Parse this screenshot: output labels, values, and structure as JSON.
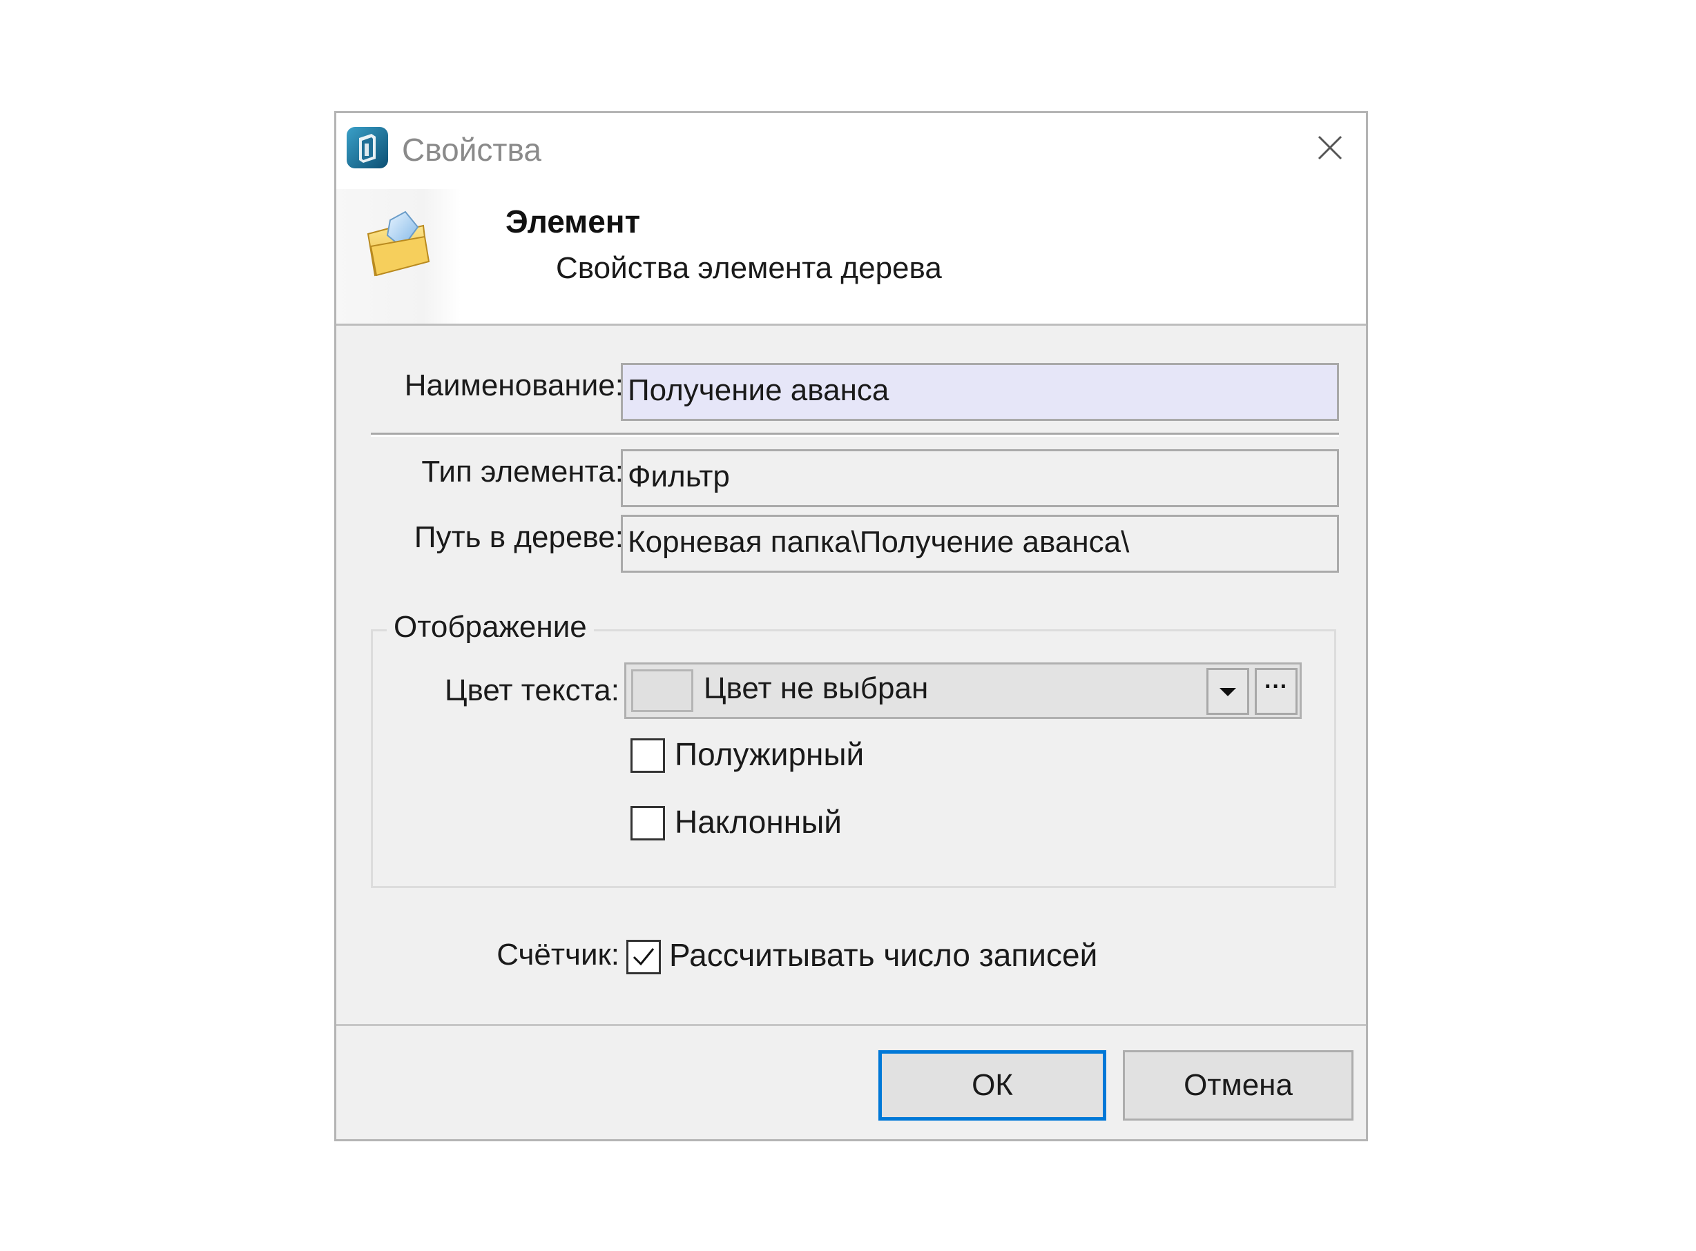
{
  "window": {
    "title": "Свойства",
    "close_icon": "close-icon"
  },
  "header": {
    "title": "Элемент",
    "subtitle": "Свойства элемента дерева",
    "icon": "folder-element-icon"
  },
  "form": {
    "name_label": "Наименование:",
    "name_value": "Получение аванса",
    "type_label": "Тип элемента:",
    "type_value": "Фильтр",
    "path_label": "Путь в дереве:",
    "path_value": "Корневая папка\\Получение аванса\\"
  },
  "display_group": {
    "legend": "Отображение",
    "text_color_label": "Цвет текста:",
    "text_color_value": "Цвет не выбран",
    "more_button": "···",
    "bold_label": "Полужирный",
    "bold_checked": false,
    "italic_label": "Наклонный",
    "italic_checked": false
  },
  "counter": {
    "label": "Счётчик:",
    "checkbox_label": "Рассчитывать число записей",
    "checked": true
  },
  "buttons": {
    "ok": "ОК",
    "cancel": "Отмена"
  },
  "colors": {
    "accent": "#0078d7",
    "active_field": "#e6e6f8",
    "dialog_bg": "#f0f0f0"
  }
}
